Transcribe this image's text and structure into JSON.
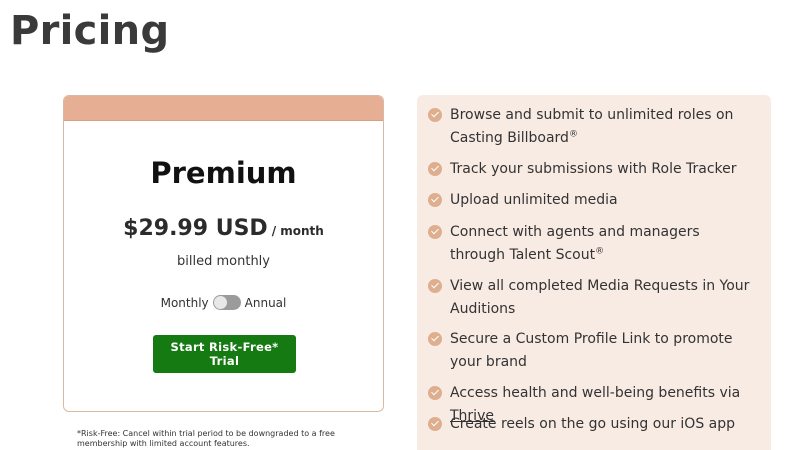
{
  "page": {
    "title": "Pricing"
  },
  "plan": {
    "name": "Premium",
    "price": "$29.99 USD",
    "period": "/ month",
    "billing_note": "billed monthly",
    "toggle": {
      "left_label": "Monthly",
      "right_label": "Annual",
      "selected": "Monthly"
    },
    "cta_label": "Start Risk-Free* Trial"
  },
  "footnote": "*Risk-Free: Cancel within trial period to be downgraded to a free membership with limited account features.",
  "features": [
    {
      "text": "Browse and submit to unlimited roles on Casting Billboard",
      "mark": "®"
    },
    {
      "text": "Track your submissions with Role Tracker"
    },
    {
      "text": "Upload unlimited media"
    },
    {
      "text": "Connect with agents and managers through Talent Scout",
      "mark": "®"
    },
    {
      "text": "View all completed Media Requests in Your Auditions"
    },
    {
      "text": "Secure a Custom Profile Link to promote your brand"
    },
    {
      "text": "Access health and well-being benefits via ",
      "link": "Thrive"
    },
    {
      "text": "Create reels on the go using our iOS app"
    }
  ],
  "colors": {
    "accent_band": "#e6ae92",
    "panel_bg": "#f8ebe4",
    "check": "#deaf8f",
    "cta_bg": "#157a12"
  },
  "icons": {
    "feature_bullet": "check-circle-icon"
  }
}
